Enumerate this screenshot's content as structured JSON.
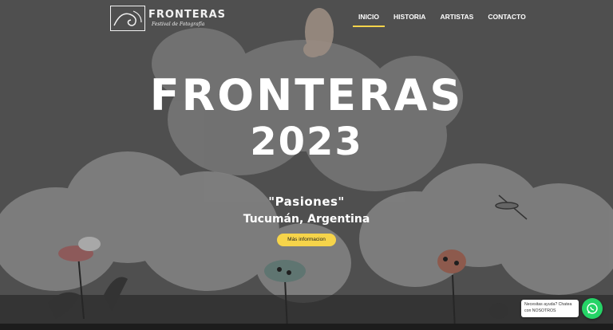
{
  "header": {
    "logo_title": "FRONTERAS",
    "logo_subtitle": "Festival de Fotografía",
    "nav": [
      {
        "label": "INICIO",
        "active": true
      },
      {
        "label": "HISTORIA",
        "active": false
      },
      {
        "label": "ARTISTAS",
        "active": false
      },
      {
        "label": "CONTACTO",
        "active": false
      }
    ]
  },
  "hero": {
    "title_line1": "FRONTERAS",
    "title_line2": "2023",
    "tagline": "\"Pasiones\"",
    "location": "Tucumán, Argentina",
    "cta_label": "Más informacion"
  },
  "chat": {
    "bubble_line1": "Necesitas ayuda? Chatea",
    "bubble_line2": "con NOSOTROS",
    "icon": "whatsapp-icon"
  },
  "colors": {
    "accent": "#f6d44a",
    "whatsapp": "#25d366"
  }
}
